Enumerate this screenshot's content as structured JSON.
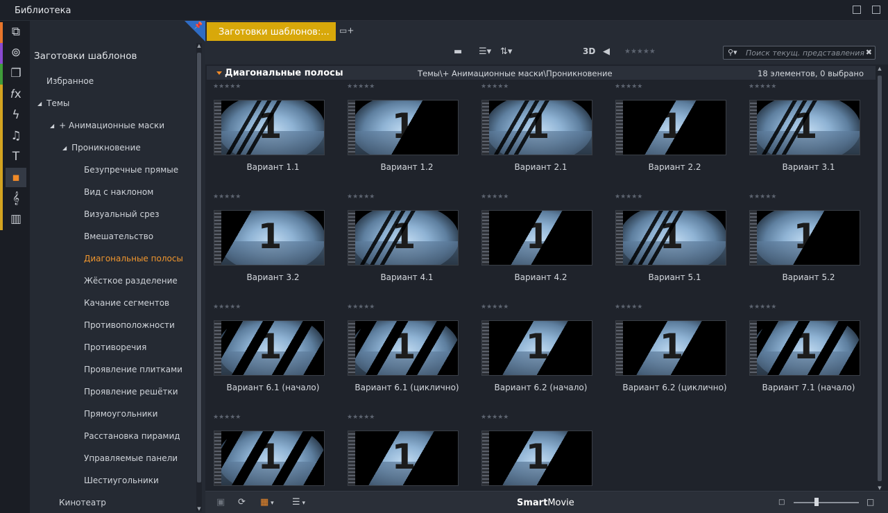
{
  "window": {
    "title": "Библиотека"
  },
  "rail": {
    "icons": [
      "stack-icon",
      "film-reel-icon",
      "pages-icon",
      "fx-icon",
      "lightning-icon",
      "music-note-icon",
      "text-t-icon",
      "shapes-icon",
      "treble-clef-icon",
      "piano-icon"
    ],
    "strip_colors": [
      "#e8752b",
      "#8a4ad0",
      "#3f9b3a",
      "#d3a320",
      "#d3a320",
      "#d3a320",
      "#d3a320",
      "#d3a320",
      "#d3a320",
      "#d3a320"
    ]
  },
  "tree": {
    "root": "Заготовки шаблонов",
    "favorites": "Избранное",
    "themes": "Темы",
    "anim_masks": "+ Анимационные маски",
    "penetration": "Проникновение",
    "items": [
      "Безупречные прямые",
      "Вид с наклоном",
      "Визуальный срез",
      "Вмешательство",
      "Диагональные полосы",
      "Жёсткое разделение",
      "Качание сегментов",
      "Противоположности",
      "Противоречия",
      "Проявление плитками",
      "Проявление решётки",
      "Прямоугольники",
      "Расстановка пирамид",
      "Управляемые панели",
      "Шестиугольники"
    ],
    "active_item": "Диагональные полосы",
    "cinema": "Кинотеатр"
  },
  "tabs": {
    "active": "Заготовки шаблонов:..."
  },
  "toolbar": {
    "mode_3d": "3D",
    "search_placeholder": "Поиск текущ. представления"
  },
  "info": {
    "folder": "Диагональные полосы",
    "path": "Темы\\+ Анимационные маски\\Проникновение",
    "count": "18 элементов, 0 выбрано"
  },
  "items": [
    {
      "label": "Вариант 1.1",
      "cut": "a"
    },
    {
      "label": "Вариант 1.2",
      "cut": "b"
    },
    {
      "label": "Вариант 2.1",
      "cut": "a"
    },
    {
      "label": "Вариант 2.2",
      "cut": "c"
    },
    {
      "label": "Вариант 3.1",
      "cut": "a"
    },
    {
      "label": "Вариант 3.2",
      "cut": "d"
    },
    {
      "label": "Вариант 4.1",
      "cut": "a"
    },
    {
      "label": "Вариант 4.2",
      "cut": "c"
    },
    {
      "label": "Вариант 5.1",
      "cut": "a"
    },
    {
      "label": "Вариант 5.2",
      "cut": "b"
    },
    {
      "label": "Вариант 6.1 (начало)",
      "cut": "e"
    },
    {
      "label": "Вариант 6.1 (циклично)",
      "cut": "e"
    },
    {
      "label": "Вариант 6.2 (начало)",
      "cut": "f"
    },
    {
      "label": "Вариант 6.2 (циклично)",
      "cut": "f"
    },
    {
      "label": "Вариант 7.1 (начало)",
      "cut": "e"
    },
    {
      "label": "",
      "cut": "e"
    },
    {
      "label": "",
      "cut": "f"
    },
    {
      "label": "",
      "cut": "f"
    }
  ],
  "bottom": {
    "brand_bold": "Smart",
    "brand_rest": "Movie"
  },
  "colors": {
    "accent_tab": "#d8a80a",
    "active_text": "#f0962e",
    "pin_corner": "#2f6cc4"
  }
}
